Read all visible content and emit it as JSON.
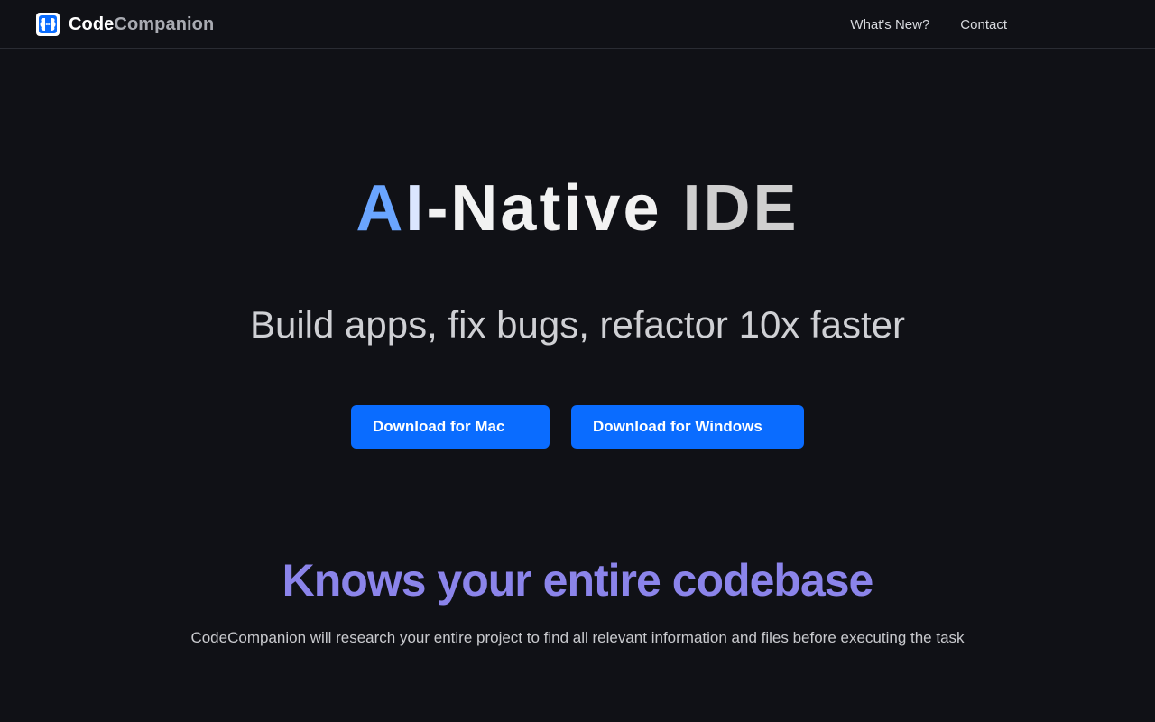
{
  "nav": {
    "brand_part1": "Code",
    "brand_part2": "Companion",
    "brand_icon": "brain-chip-icon",
    "links": [
      {
        "label": "What's New?"
      },
      {
        "label": "Contact"
      }
    ]
  },
  "hero": {
    "title_a": "A",
    "title_i": "I",
    "title_rest": "-Native ",
    "title_ide": "IDE",
    "subtitle": "Build apps, fix bugs, refactor 10x faster"
  },
  "buttons": {
    "mac": "Download for Mac",
    "windows": "Download for Windows"
  },
  "section": {
    "title": "Knows your entire codebase",
    "description": "CodeCompanion will research your entire project to find all relevant information and files before executing the task"
  },
  "colors": {
    "background": "#101116",
    "accent": "#0a6cff",
    "section_title": "#8b84ea"
  }
}
